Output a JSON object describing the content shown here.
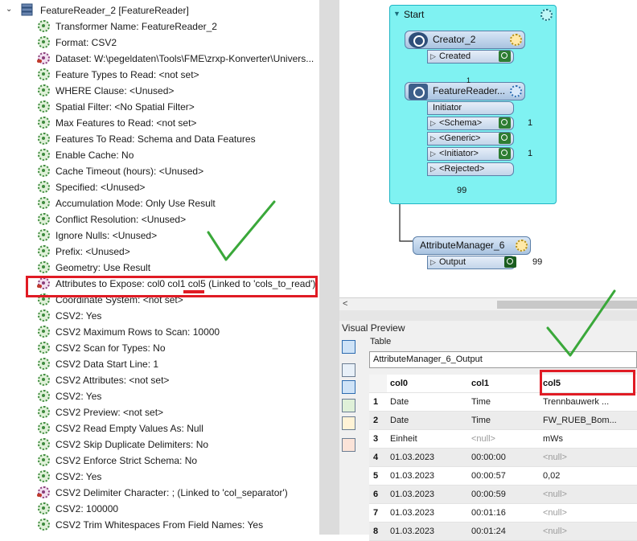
{
  "tree": {
    "header_label": "FeatureReader_2 [FeatureReader]",
    "items": [
      {
        "text": "Transformer Name: FeatureReader_2",
        "linked": false
      },
      {
        "text": "Format: CSV2",
        "linked": false
      },
      {
        "text": "Dataset: W:\\pegeldaten\\Tools\\FME\\zrxp-Konverter\\Univers...",
        "linked": true
      },
      {
        "text": "Feature Types to Read: <not set>",
        "linked": false
      },
      {
        "text": "WHERE Clause: <Unused>",
        "linked": false
      },
      {
        "text": "Spatial Filter: <No Spatial Filter>",
        "linked": false
      },
      {
        "text": "Max Features to Read: <not set>",
        "linked": false
      },
      {
        "text": "Features To Read: Schema and Data Features",
        "linked": false
      },
      {
        "text": "Enable Cache: No",
        "linked": false
      },
      {
        "text": "Cache Timeout (hours): <Unused>",
        "linked": false
      },
      {
        "text": "Specified: <Unused>",
        "linked": false
      },
      {
        "text": "Accumulation Mode: Only Use Result",
        "linked": false
      },
      {
        "text": "Conflict Resolution: <Unused>",
        "linked": false
      },
      {
        "text": "Ignore Nulls: <Unused>",
        "linked": false
      },
      {
        "text": "Prefix: <Unused>",
        "linked": false
      },
      {
        "text": "Geometry: Use Result",
        "linked": false
      },
      {
        "text": "Attributes to Expose: col0 col1 col5 (Linked to 'cols_to_read')",
        "linked": true
      },
      {
        "text": "Coordinate System: <not set>",
        "linked": false
      },
      {
        "text": "CSV2: Yes",
        "linked": false
      },
      {
        "text": "CSV2 Maximum Rows to Scan: 10000",
        "linked": false
      },
      {
        "text": "CSV2 Scan for Types: No",
        "linked": false
      },
      {
        "text": "CSV2 Data Start Line: 1",
        "linked": false
      },
      {
        "text": "CSV2 Attributes: <not set>",
        "linked": false
      },
      {
        "text": "CSV2: Yes",
        "linked": false
      },
      {
        "text": "CSV2 Preview: <not set>",
        "linked": false
      },
      {
        "text": "CSV2 Read Empty Values As: Null",
        "linked": false
      },
      {
        "text": "CSV2 Skip Duplicate Delimiters: No",
        "linked": false
      },
      {
        "text": "CSV2 Enforce Strict Schema: No",
        "linked": false
      },
      {
        "text": "CSV2: Yes",
        "linked": false
      },
      {
        "text": "CSV2 Delimiter Character: ; (Linked to 'col_separator')",
        "linked": true
      },
      {
        "text": "CSV2: 100000",
        "linked": false
      },
      {
        "text": "CSV2 Trim Whitespaces From Field Names: Yes",
        "linked": false
      }
    ]
  },
  "canvas": {
    "bookmark_title": "Start",
    "creator": {
      "name": "Creator_2",
      "port": "Created"
    },
    "reader": {
      "name": "FeatureReader...",
      "input_port": "Initiator",
      "ports": [
        {
          "label": "<Schema>",
          "count": "1"
        },
        {
          "label": "<Generic>",
          "count": ""
        },
        {
          "label": "<Initiator>",
          "count": "1"
        },
        {
          "label": "<Rejected>",
          "count": ""
        }
      ],
      "link_count_small": "1"
    },
    "connection_count": "99",
    "manager": {
      "name": "AttributeManager_6",
      "port": "Output",
      "count": "99"
    },
    "scroll_left": "<"
  },
  "preview": {
    "title": "Visual Preview",
    "tab_label": "Table",
    "table_name": "AttributeManager_6_Output",
    "columns": [
      "col0",
      "col1",
      "col5"
    ],
    "rows": [
      {
        "n": "1",
        "cells": [
          "Date",
          "Time",
          "Trennbauwerk ..."
        ]
      },
      {
        "n": "2",
        "cells": [
          "Date",
          "Time",
          "FW_RUEB_Bom..."
        ]
      },
      {
        "n": "3",
        "cells": [
          "Einheit",
          "<null>",
          "mWs"
        ]
      },
      {
        "n": "4",
        "cells": [
          "01.03.2023",
          "00:00:00",
          "<null>"
        ]
      },
      {
        "n": "5",
        "cells": [
          "01.03.2023",
          "00:00:57",
          "0,02"
        ]
      },
      {
        "n": "6",
        "cells": [
          "01.03.2023",
          "00:00:59",
          "<null>"
        ]
      },
      {
        "n": "7",
        "cells": [
          "01.03.2023",
          "00:01:16",
          "<null>"
        ]
      },
      {
        "n": "8",
        "cells": [
          "01.03.2023",
          "00:01:24",
          "<null>"
        ]
      }
    ]
  },
  "colors": {
    "highlight_red": "#e01b24",
    "check_green": "#3aa83a",
    "bookmark_cyan": "#7ff2f2"
  },
  "icons": {
    "tree_expand": "chevron-down-icon",
    "tree_node": "feature-reader-icon",
    "parameter": "gear-icon",
    "linked_parameter": "linked-gear-icon"
  }
}
